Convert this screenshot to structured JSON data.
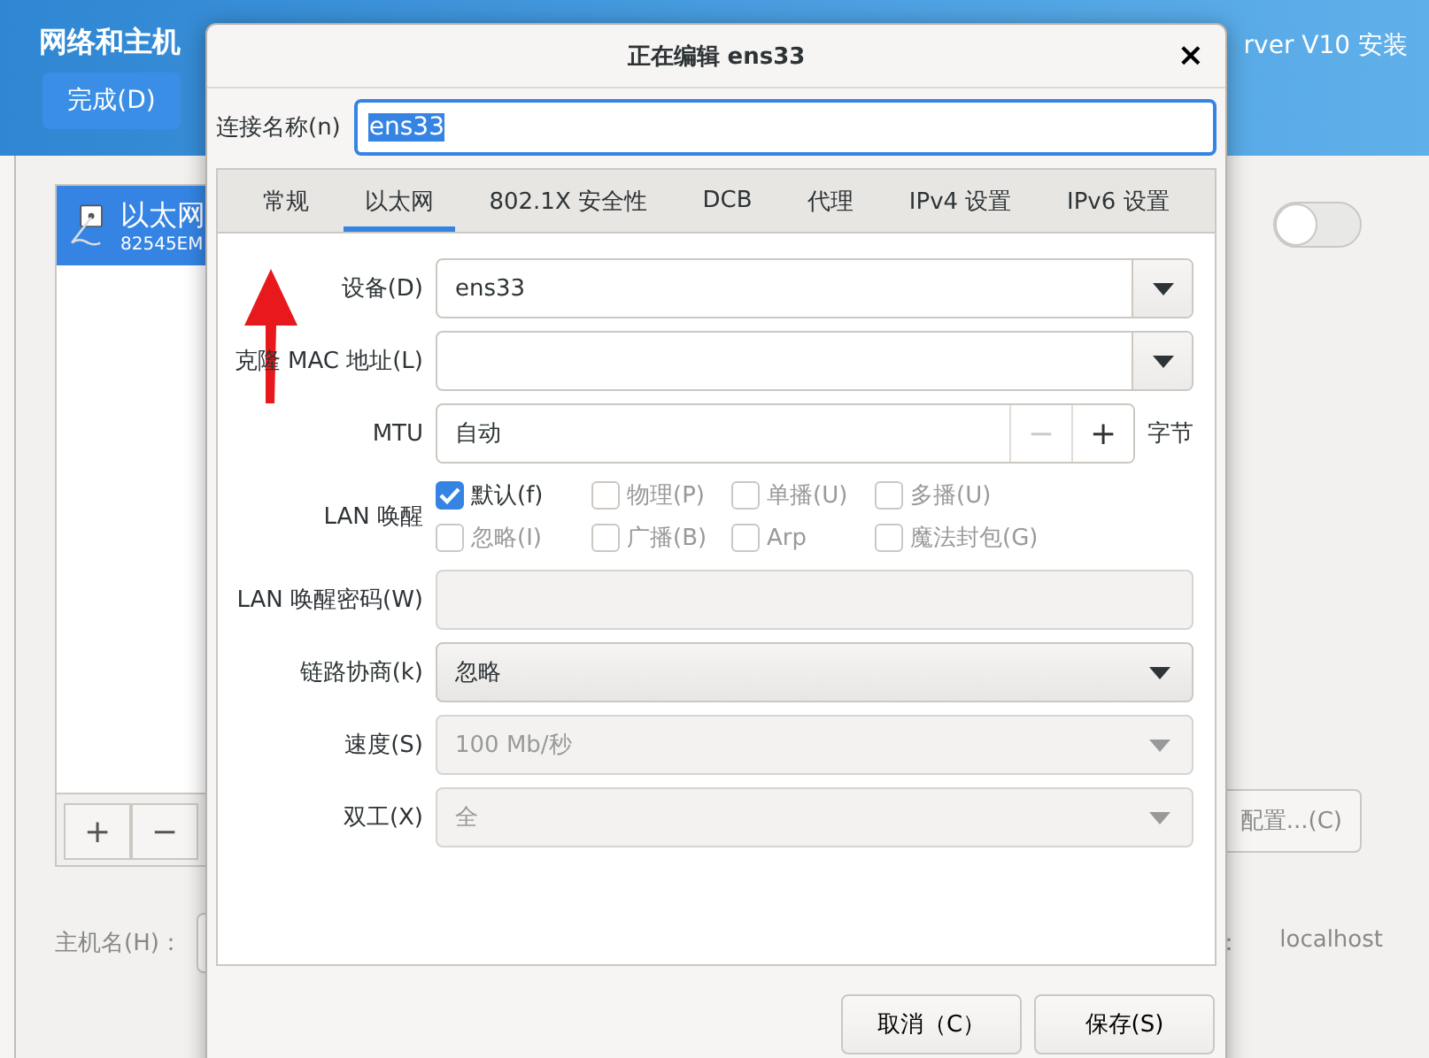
{
  "background": {
    "header_title": "网络和主机",
    "header_right": "rver V10 安装",
    "done_button": "完成(D)",
    "connections": [
      {
        "name": "以太网",
        "detail": "82545EM",
        "selected": true
      }
    ],
    "add_button": "+",
    "remove_button": "−",
    "switch": {
      "on": false
    },
    "configure_button": "配置...(C)",
    "hostname_label": "主机名(H)：",
    "current_hostname_label": "：",
    "current_hostname": "localhost"
  },
  "dialog": {
    "title": "正在编辑 ens33",
    "close": "×",
    "connection_name_label": "连接名称(n)",
    "connection_name": "ens33",
    "tabs": [
      {
        "label": "常规",
        "selected": false
      },
      {
        "label": "以太网",
        "selected": true
      },
      {
        "label": "802.1X 安全性",
        "selected": false
      },
      {
        "label": "DCB",
        "selected": false
      },
      {
        "label": "代理",
        "selected": false
      },
      {
        "label": "IPv4 设置",
        "selected": false
      },
      {
        "label": "IPv6 设置",
        "selected": false
      }
    ],
    "rows": [
      {
        "kind": "combo",
        "label": "设备(D)",
        "value": "ens33"
      },
      {
        "kind": "combo",
        "label": "克隆 MAC 地址(L)",
        "value": ""
      },
      {
        "kind": "spin",
        "label": "MTU",
        "value": "自动",
        "minus": "−",
        "plus": "+",
        "unit": "字节"
      },
      {
        "kind": "checks",
        "label": "LAN 唤醒",
        "checks": [
          {
            "label": "默认(f)",
            "checked": true,
            "disabled": false
          },
          {
            "label": "物理(P)",
            "checked": false,
            "disabled": true
          },
          {
            "label": "单播(U)",
            "checked": false,
            "disabled": true
          },
          {
            "label": "多播(U)",
            "checked": false,
            "disabled": true
          },
          {
            "label": "忽略(I)",
            "checked": false,
            "disabled": true
          },
          {
            "label": "广播(B)",
            "checked": false,
            "disabled": true
          },
          {
            "label": "Arp",
            "checked": false,
            "disabled": true
          },
          {
            "label": "魔法封包(G)",
            "checked": false,
            "disabled": true
          }
        ]
      },
      {
        "kind": "entry",
        "label": "LAN 唤醒密码(W)",
        "value": "",
        "disabled": true
      },
      {
        "kind": "dropdown",
        "label": "链路协商(k)",
        "value": "忽略",
        "disabled": false
      },
      {
        "kind": "dropdown",
        "label": "速度(S)",
        "value": "100 Mb/秒",
        "disabled": true
      },
      {
        "kind": "dropdown",
        "label": "双工(X)",
        "value": "全",
        "disabled": true
      }
    ],
    "buttons": [
      "取消（C）",
      "保存(S)"
    ]
  }
}
